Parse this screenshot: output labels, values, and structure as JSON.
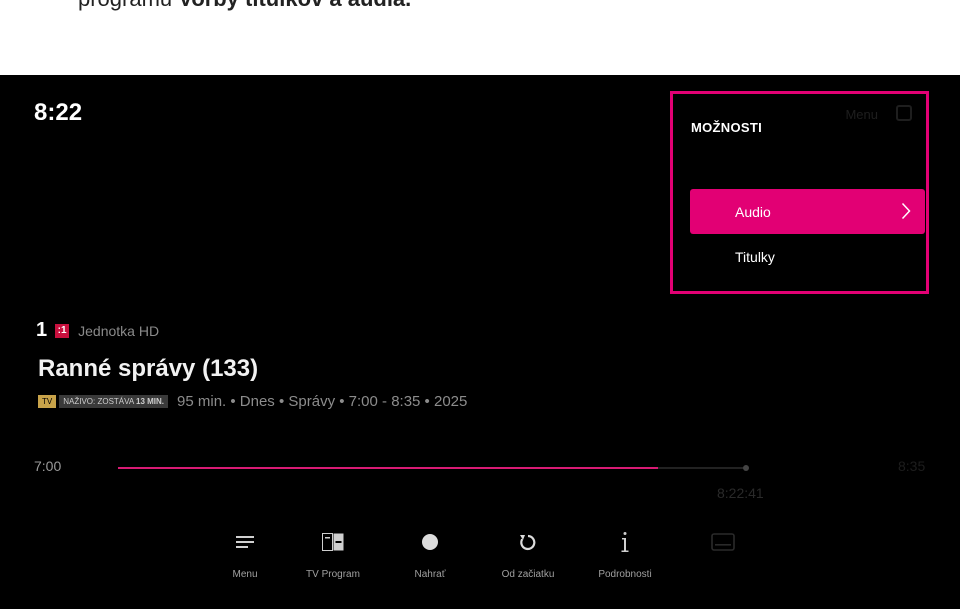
{
  "caption": {
    "normal": "programu ",
    "bold": "Voľby titulkov a audia."
  },
  "player": {
    "clock": "8:22",
    "channel": {
      "number": "1",
      "logo": ":1",
      "name": "Jednotka HD"
    },
    "program": {
      "title": "Ranné správy (133)",
      "badge_tv": "TV",
      "badge_live_prefix": "NAŽIVO: ZOSTÁVA ",
      "badge_live_bold": "13 MIN.",
      "meta": "95 min. • Dnes • Správy • 7:00 - 8:35 • 2025"
    },
    "timeline": {
      "start": "7:00",
      "end": "8:35",
      "current": "8:22:41",
      "progress": 0.86
    }
  },
  "toolbar": {
    "items": [
      {
        "label": "Menu",
        "icon": "menu-icon"
      },
      {
        "label": "TV Program",
        "icon": "tv-guide-icon"
      },
      {
        "label": "Nahrať",
        "icon": "record-icon"
      },
      {
        "label": "Od začiatku",
        "icon": "restart-icon"
      },
      {
        "label": "Podrobnosti",
        "icon": "info-icon"
      },
      {
        "label": "",
        "icon": "subtitles-icon"
      }
    ]
  },
  "options_panel": {
    "title": "MOŽNOSTI",
    "menu_hint": "Menu",
    "items": [
      {
        "label": "Audio",
        "selected": true
      },
      {
        "label": "Titulky",
        "selected": false
      }
    ],
    "highlight_color": "#e20074"
  },
  "colors": {
    "accent": "#e20074",
    "progress": "#d81b74",
    "badge_tv": "#c8a34a",
    "channel_logo": "#c8103e"
  }
}
